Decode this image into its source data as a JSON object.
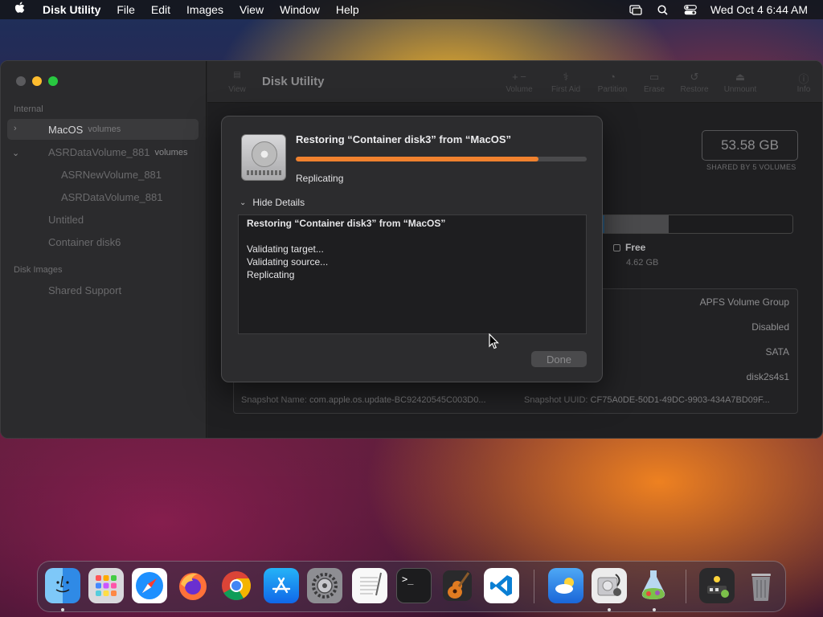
{
  "menubar": {
    "apple_icon": "apple-logo-icon",
    "app_name": "Disk Utility",
    "items": [
      "File",
      "Edit",
      "Images",
      "View",
      "Window",
      "Help"
    ],
    "clock": "Wed Oct 4  6:44 AM"
  },
  "sidebar": {
    "section_internal": "Internal",
    "items": [
      {
        "label": "MacOS",
        "tag": "volumes"
      },
      {
        "label": "ASRDataVolume_881",
        "tag": "volumes"
      },
      {
        "label": "ASRNewVolume_881"
      },
      {
        "label": "ASRDataVolume_881"
      },
      {
        "label": "Untitled"
      },
      {
        "label": "Container disk6"
      }
    ],
    "section_images": "Disk Images",
    "image_item": "Shared Support"
  },
  "toolbar": {
    "view_label": "View",
    "title": "Disk Utility",
    "buttons": [
      "Volume",
      "First Aid",
      "Partition",
      "Erase",
      "Restore",
      "Unmount",
      "Info"
    ]
  },
  "main": {
    "capacity": "53.58 GB",
    "capacity_sub": "SHARED BY 5 VOLUMES",
    "free_label": "Free",
    "free_value": "4.62 GB",
    "usage_fractions": {
      "used": 0.4766,
      "other": 0.1782,
      "free": 0.3452
    },
    "info_values": [
      "APFS Volume Group",
      "Disabled",
      "SATA",
      "disk2s4s1"
    ],
    "snapshot_name_label": "Snapshot Name:",
    "snapshot_name_value": "com.apple.os.update-BC92420545C003D0...",
    "snapshot_uuid_label": "Snapshot UUID:",
    "snapshot_uuid_value": "CF75A0DE-50D1-49DC-9903-434A7BD09F..."
  },
  "dialog": {
    "title": "Restoring “Container disk3” from “MacOS”",
    "progress": 0.835,
    "status": "Replicating",
    "toggle_label": "Hide Details",
    "log_head": "Restoring “Container disk3” from “MacOS”",
    "log_lines": [
      "Validating target...",
      "Validating source...",
      "Replicating"
    ],
    "done_label": "Done"
  },
  "dock": {
    "apps": [
      "finder-icon",
      "launchpad-icon",
      "safari-icon",
      "firefox-icon",
      "chrome-icon",
      "app-store-icon",
      "system-settings-icon",
      "textedit-icon",
      "terminal-icon",
      "garageband-icon",
      "vscode-icon",
      "weather-icon",
      "disk-utility-icon",
      "potion-icon",
      "downloads-stack-icon",
      "trash-icon"
    ]
  },
  "colors": {
    "progress_accent": "#f0812e",
    "traffic_min": "#febc2e",
    "traffic_max": "#28c840"
  }
}
